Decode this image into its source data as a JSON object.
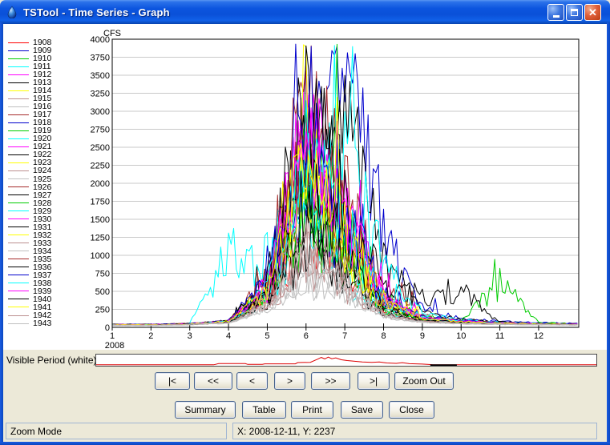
{
  "window": {
    "title": "TSTool - Time Series - Graph"
  },
  "icons": {
    "titlebar": "water-drop-icon",
    "minimize": "minimize-icon",
    "maximize": "maximize-icon",
    "close": "close-x-icon"
  },
  "colors": {
    "titlebar_blue": "#0c55df",
    "window_border": "#0a47c0",
    "canvas_bg": "#ffffff",
    "dialog_bg": "#ece9d8",
    "gridline": "#c9c9c9",
    "overview_line": "#dd0000"
  },
  "chart_data": {
    "type": "line",
    "title": "",
    "xlabel": "",
    "ylabel": "CFS",
    "x_axis_year": "2008",
    "x_ticks": [
      1,
      2,
      3,
      4,
      5,
      6,
      7,
      8,
      9,
      10,
      11,
      12
    ],
    "x_min": 1,
    "x_max": 13.04,
    "y_min": 0,
    "y_max": 4000,
    "y_tick_step": 250,
    "grid": "horizontal-only",
    "legend_position": "left",
    "units": "CFS",
    "series": [
      {
        "name": "1908",
        "color": "#ff0000",
        "monthly": [
          35,
          35,
          45,
          90,
          420,
          1500,
          900,
          250,
          100,
          70,
          55,
          45,
          40
        ]
      },
      {
        "name": "1909",
        "color": "#0000cd",
        "monthly": [
          40,
          40,
          50,
          95,
          650,
          2500,
          3950,
          1200,
          260,
          120,
          85,
          65,
          55
        ]
      },
      {
        "name": "1910",
        "color": "#00cc00",
        "monthly": [
          38,
          38,
          48,
          85,
          560,
          2900,
          1600,
          420,
          150,
          90,
          65,
          50,
          45
        ]
      },
      {
        "name": "1911",
        "color": "#00ffff",
        "monthly": [
          30,
          32,
          60,
          950,
          1050,
          1500,
          700,
          200,
          90,
          65,
          50,
          42,
          38
        ]
      },
      {
        "name": "1912",
        "color": "#ff00ff",
        "monthly": [
          36,
          36,
          46,
          88,
          540,
          2750,
          1500,
          380,
          130,
          85,
          60,
          48,
          42
        ]
      },
      {
        "name": "1913",
        "color": "#000000",
        "monthly": [
          42,
          40,
          50,
          92,
          600,
          2300,
          3250,
          900,
          210,
          110,
          75,
          58,
          50
        ]
      },
      {
        "name": "1914",
        "color": "#ffff00",
        "monthly": [
          34,
          34,
          44,
          82,
          480,
          2400,
          1300,
          330,
          120,
          80,
          58,
          46,
          40
        ]
      },
      {
        "name": "1915",
        "color": "#bc8f8f",
        "monthly": [
          30,
          30,
          40,
          70,
          350,
          1200,
          700,
          200,
          85,
          60,
          48,
          40,
          36
        ]
      },
      {
        "name": "1916",
        "color": "#c0c0c0",
        "monthly": [
          28,
          28,
          38,
          65,
          300,
          900,
          550,
          160,
          75,
          55,
          45,
          38,
          34
        ]
      },
      {
        "name": "1917",
        "color": "#a52a2a",
        "monthly": [
          44,
          42,
          52,
          95,
          620,
          3300,
          1900,
          500,
          170,
          95,
          68,
          54,
          48
        ]
      },
      {
        "name": "1918",
        "color": "#0000cd",
        "monthly": [
          36,
          36,
          46,
          84,
          470,
          2100,
          1200,
          310,
          115,
          78,
          57,
          46,
          40
        ]
      },
      {
        "name": "1919",
        "color": "#00cc00",
        "monthly": [
          33,
          33,
          43,
          78,
          420,
          1700,
          950,
          260,
          100,
          70,
          52,
          43,
          38
        ]
      },
      {
        "name": "1920",
        "color": "#00ffff",
        "monthly": [
          35,
          35,
          45,
          80,
          380,
          1400,
          2600,
          800,
          190,
          100,
          70,
          54,
          46
        ]
      },
      {
        "name": "1921",
        "color": "#ff00ff",
        "monthly": [
          38,
          38,
          48,
          88,
          560,
          2850,
          1550,
          400,
          140,
          88,
          62,
          50,
          44
        ]
      },
      {
        "name": "1922",
        "color": "#000000",
        "monthly": [
          34,
          34,
          44,
          80,
          440,
          1900,
          1050,
          280,
          105,
          72,
          54,
          44,
          39
        ]
      },
      {
        "name": "1923",
        "color": "#ffff00",
        "monthly": [
          35,
          35,
          45,
          82,
          460,
          2300,
          1250,
          320,
          118,
          78,
          57,
          46,
          40
        ]
      },
      {
        "name": "1924",
        "color": "#bc8f8f",
        "monthly": [
          29,
          29,
          39,
          68,
          320,
          1000,
          600,
          170,
          78,
          56,
          46,
          39,
          35
        ]
      },
      {
        "name": "1925",
        "color": "#c0c0c0",
        "monthly": [
          27,
          27,
          37,
          62,
          280,
          800,
          500,
          150,
          70,
          52,
          43,
          37,
          33
        ]
      },
      {
        "name": "1926",
        "color": "#a52a2a",
        "monthly": [
          37,
          37,
          47,
          86,
          500,
          2500,
          1400,
          360,
          125,
          82,
          60,
          48,
          42
        ]
      },
      {
        "name": "1927",
        "color": "#000000",
        "monthly": [
          35,
          35,
          45,
          82,
          450,
          2000,
          1100,
          290,
          108,
          74,
          55,
          45,
          40
        ]
      },
      {
        "name": "1928",
        "color": "#00cc00",
        "monthly": [
          32,
          32,
          42,
          76,
          400,
          1600,
          900,
          240,
          95,
          80,
          620,
          70,
          45
        ]
      },
      {
        "name": "1929",
        "color": "#00ffff",
        "monthly": [
          36,
          36,
          46,
          84,
          470,
          2200,
          1250,
          320,
          118,
          78,
          57,
          46,
          40
        ]
      },
      {
        "name": "1930",
        "color": "#ff00ff",
        "monthly": [
          38,
          38,
          48,
          88,
          540,
          2700,
          1500,
          390,
          135,
          86,
          61,
          49,
          43
        ]
      },
      {
        "name": "1931",
        "color": "#000000",
        "monthly": [
          30,
          30,
          40,
          70,
          330,
          1100,
          650,
          190,
          82,
          58,
          47,
          40,
          36
        ]
      },
      {
        "name": "1932",
        "color": "#ffff00",
        "monthly": [
          36,
          36,
          46,
          84,
          480,
          2450,
          1350,
          340,
          122,
          80,
          58,
          47,
          41
        ]
      },
      {
        "name": "1933",
        "color": "#bc8f8f",
        "monthly": [
          28,
          28,
          38,
          66,
          300,
          950,
          570,
          165,
          76,
          55,
          45,
          38,
          34
        ]
      },
      {
        "name": "1934",
        "color": "#c0c0c0",
        "monthly": [
          26,
          26,
          36,
          60,
          260,
          700,
          450,
          140,
          66,
          50,
          42,
          36,
          32
        ]
      },
      {
        "name": "1935",
        "color": "#a52a2a",
        "monthly": [
          37,
          37,
          47,
          86,
          510,
          2600,
          1450,
          370,
          128,
          84,
          60,
          48,
          42
        ]
      },
      {
        "name": "1936",
        "color": "#000000",
        "monthly": [
          42,
          40,
          50,
          92,
          600,
          3200,
          1800,
          480,
          450,
          500,
          60,
          50,
          45
        ]
      },
      {
        "name": "1937",
        "color": "#0000cd",
        "monthly": [
          40,
          40,
          50,
          90,
          580,
          3000,
          1700,
          450,
          155,
          92,
          66,
          52,
          46
        ]
      },
      {
        "name": "1938",
        "color": "#00ffff",
        "monthly": [
          36,
          36,
          46,
          84,
          490,
          2550,
          1400,
          360,
          126,
          82,
          59,
          47,
          41
        ]
      },
      {
        "name": "1939",
        "color": "#ff00ff",
        "monthly": [
          37,
          37,
          47,
          86,
          520,
          2650,
          1480,
          380,
          130,
          84,
          60,
          48,
          42
        ]
      },
      {
        "name": "1940",
        "color": "#000000",
        "monthly": [
          34,
          34,
          44,
          80,
          430,
          1850,
          1020,
          270,
          102,
          71,
          53,
          44,
          39
        ]
      },
      {
        "name": "1941",
        "color": "#ffff00",
        "monthly": [
          35,
          35,
          45,
          82,
          470,
          2350,
          1280,
          330,
          120,
          79,
          57,
          46,
          40
        ]
      },
      {
        "name": "1942",
        "color": "#bc8f8f",
        "monthly": [
          31,
          31,
          41,
          72,
          360,
          1300,
          750,
          210,
          88,
          62,
          49,
          41,
          37
        ]
      },
      {
        "name": "1943",
        "color": "#c0c0c0",
        "monthly": [
          27,
          27,
          37,
          63,
          290,
          850,
          520,
          155,
          72,
          53,
          44,
          37,
          33
        ]
      }
    ]
  },
  "overview": {
    "label": "Visible Period (white):",
    "line_color": "#dd0000",
    "points": [
      [
        0,
        0.05
      ],
      [
        0.235,
        0.05
      ],
      [
        0.245,
        0.17
      ],
      [
        0.298,
        0.17
      ],
      [
        0.303,
        0.09
      ],
      [
        0.332,
        0.09
      ],
      [
        0.337,
        0.15
      ],
      [
        0.398,
        0.15
      ],
      [
        0.403,
        0.27
      ],
      [
        0.428,
        0.29
      ],
      [
        0.443,
        0.6
      ],
      [
        0.45,
        0.76
      ],
      [
        0.457,
        0.62
      ],
      [
        0.464,
        0.79
      ],
      [
        0.471,
        0.64
      ],
      [
        0.479,
        0.72
      ],
      [
        0.49,
        0.54
      ],
      [
        0.502,
        0.46
      ],
      [
        0.517,
        0.39
      ],
      [
        0.532,
        0.33
      ],
      [
        0.551,
        0.29
      ],
      [
        0.566,
        0.32
      ],
      [
        0.581,
        0.23
      ],
      [
        0.6,
        0.19
      ],
      [
        0.612,
        0.26
      ],
      [
        0.626,
        0.16
      ],
      [
        0.652,
        0.12
      ],
      [
        0.672,
        0.07
      ],
      [
        0.7,
        0.05
      ],
      [
        1,
        0.05
      ]
    ],
    "marker_segment": [
      0.668,
      0.721
    ]
  },
  "nav_buttons": [
    {
      "label": "|<"
    },
    {
      "label": "<<"
    },
    {
      "label": "<"
    },
    {
      "label": ">"
    },
    {
      "label": ">>"
    },
    {
      "label": ">|"
    },
    {
      "label": "Zoom Out"
    }
  ],
  "action_buttons": [
    {
      "label": "Summary"
    },
    {
      "label": "Table"
    },
    {
      "label": "Print"
    },
    {
      "label": "Save"
    },
    {
      "label": "Close"
    }
  ],
  "status": {
    "mode": "Zoom Mode",
    "coords": "X: 2008-12-11, Y: 2237"
  }
}
